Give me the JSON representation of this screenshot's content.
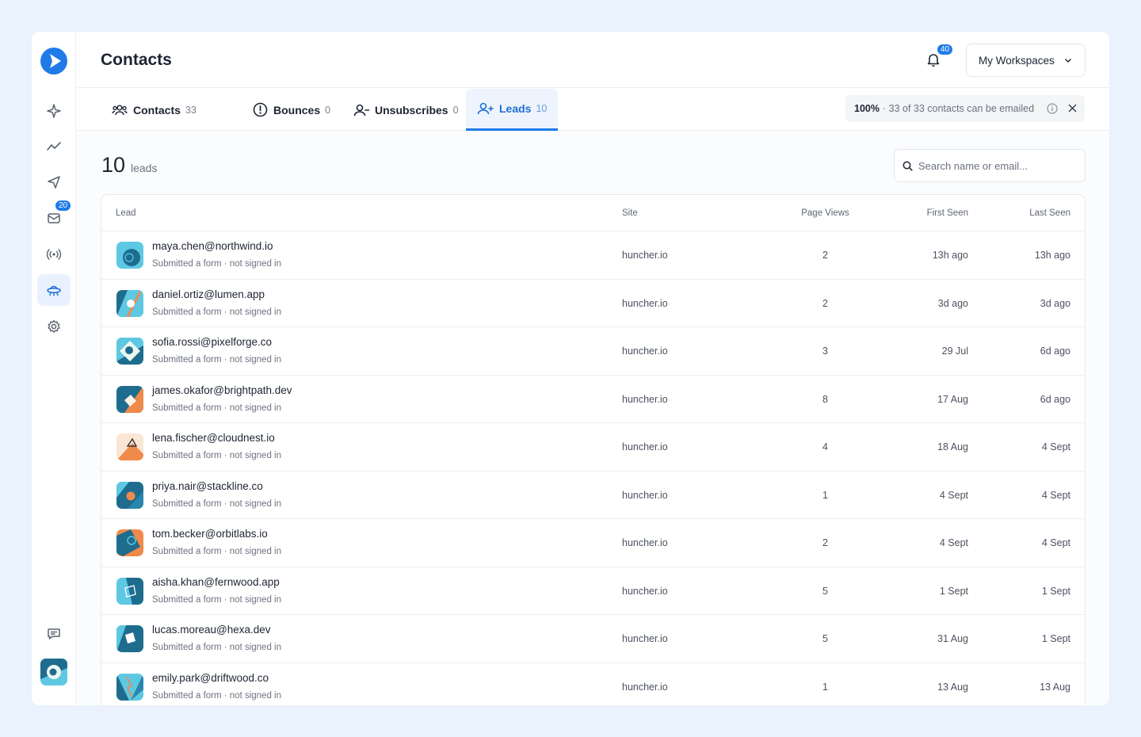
{
  "sidebar": {
    "logo": "play-logo",
    "mail_badge": "20",
    "items": [
      {
        "name": "sparkle-icon"
      },
      {
        "name": "trend-icon"
      },
      {
        "name": "send-icon"
      },
      {
        "name": "mail-icon"
      },
      {
        "name": "broadcast-icon"
      },
      {
        "name": "ufo-icon"
      },
      {
        "name": "gear-icon"
      }
    ],
    "feedback_icon": "chat-icon"
  },
  "header": {
    "title": "Contacts",
    "notification_count": "40",
    "workspace_label": "My Workspaces"
  },
  "tabs": [
    {
      "label": "Contacts",
      "count": "33"
    },
    {
      "label": "Bounces",
      "count": "0"
    },
    {
      "label": "Unsubscribes",
      "count": "0"
    },
    {
      "label": "Leads",
      "count": "10"
    }
  ],
  "email_status": {
    "percent": "100%",
    "text": "· 33 of 33 contacts can be emailed"
  },
  "summary": {
    "count": "10",
    "label": "leads"
  },
  "search": {
    "placeholder": "Search name or email..."
  },
  "table": {
    "columns": [
      "Lead",
      "Site",
      "Page Views",
      "First Seen",
      "Last Seen"
    ],
    "rows": [
      {
        "email": "maya.chen@northwind.io",
        "sub": "Submitted a form · not signed in",
        "site": "huncher.io",
        "views": "2",
        "first": "13h ago",
        "last": "13h ago"
      },
      {
        "email": "daniel.ortiz@lumen.app",
        "sub": "Submitted a form · not signed in",
        "site": "huncher.io",
        "views": "2",
        "first": "3d ago",
        "last": "3d ago"
      },
      {
        "email": "sofia.rossi@pixelforge.co",
        "sub": "Submitted a form · not signed in",
        "site": "huncher.io",
        "views": "3",
        "first": "29 Jul",
        "last": "6d ago"
      },
      {
        "email": "james.okafor@brightpath.dev",
        "sub": "Submitted a form · not signed in",
        "site": "huncher.io",
        "views": "8",
        "first": "17 Aug",
        "last": "6d ago"
      },
      {
        "email": "lena.fischer@cloudnest.io",
        "sub": "Submitted a form · not signed in",
        "site": "huncher.io",
        "views": "4",
        "first": "18 Aug",
        "last": "4 Sept"
      },
      {
        "email": "priya.nair@stackline.co",
        "sub": "Submitted a form · not signed in",
        "site": "huncher.io",
        "views": "1",
        "first": "4 Sept",
        "last": "4 Sept"
      },
      {
        "email": "tom.becker@orbitlabs.io",
        "sub": "Submitted a form · not signed in",
        "site": "huncher.io",
        "views": "2",
        "first": "4 Sept",
        "last": "4 Sept"
      },
      {
        "email": "aisha.khan@fernwood.app",
        "sub": "Submitted a form · not signed in",
        "site": "huncher.io",
        "views": "5",
        "first": "1 Sept",
        "last": "1 Sept"
      },
      {
        "email": "lucas.moreau@hexa.dev",
        "sub": "Submitted a form · not signed in",
        "site": "huncher.io",
        "views": "5",
        "first": "31 Aug",
        "last": "1 Sept"
      },
      {
        "email": "emily.park@driftwood.co",
        "sub": "Submitted a form · not signed in",
        "site": "huncher.io",
        "views": "1",
        "first": "13 Aug",
        "last": "13 Aug"
      }
    ]
  },
  "colors": {
    "accent": "#1f7ae8",
    "teal": "#1e6d8e",
    "orange": "#f08a4b",
    "cyan": "#5ec8e3"
  }
}
